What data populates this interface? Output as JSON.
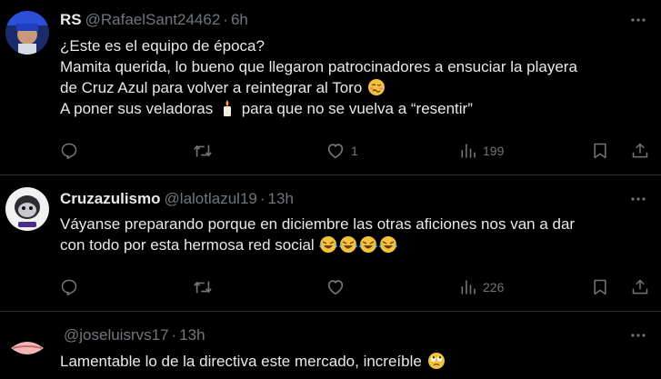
{
  "tweets": [
    {
      "display_name": "RS",
      "handle": "@RafaelSant24462",
      "separator": "·",
      "time": "6h",
      "lines": [
        "¿Este es el equipo de época?",
        "Mamita querida, lo bueno que llegaron patrocinadores a ensuciar la playera",
        "de Cruz Azul para volver a reintegrar al Toro",
        "A poner sus veladoras",
        "para que no se vuelva a “resentir”"
      ],
      "replies": "",
      "retweets": "",
      "likes": "1",
      "views": "199"
    },
    {
      "display_name": "Cruzazulismo",
      "handle": "@lalotlazul19",
      "separator": "·",
      "time": "13h",
      "lines": [
        "Váyanse preparando porque en diciembre las otras aficiones nos van a dar",
        "con todo por esta hermosa red social"
      ],
      "replies": "",
      "retweets": "",
      "likes": "",
      "views": "226"
    },
    {
      "display_name": "",
      "handle": "@joseluisrvs17",
      "separator": "·",
      "time": "13h",
      "lines": [
        "Lamentable lo de la directiva este mercado, increíble"
      ]
    }
  ],
  "icons": {
    "reply": "reply-icon",
    "retweet": "retweet-icon",
    "like": "heart-icon",
    "views": "views-icon",
    "bookmark": "bookmark-icon",
    "share": "share-icon",
    "more": "more-icon"
  },
  "colors": {
    "background": "#000000",
    "text": "#e7e9ea",
    "muted": "#71767b",
    "divider": "#2f3336"
  }
}
